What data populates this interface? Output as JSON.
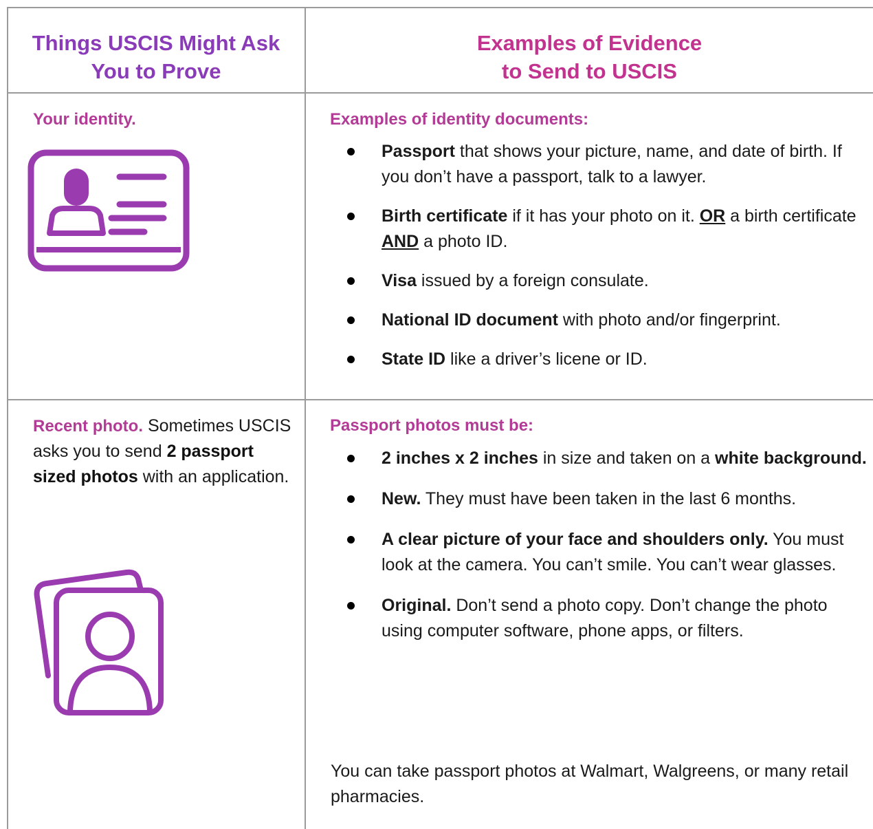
{
  "header": {
    "left_line1": "Things USCIS Might Ask",
    "left_line2": "You to Prove",
    "right_line1": "Examples of Evidence",
    "right_line2": "to Send to USCIS"
  },
  "row1": {
    "left_label": "Your identity.",
    "icon": "id-card-icon",
    "right_title": "Examples of identity documents:",
    "items": [
      {
        "bold": "Passport",
        "text": " that shows your picture, name, and date of birth. If you don’t have a passport, talk to a lawyer."
      },
      {
        "bold": "Birth certificate",
        "text": " if it has your photo on it. ",
        "or": "OR",
        "text2": " a birth certificate ",
        "and": "AND",
        "text3": " a photo ID."
      },
      {
        "bold": "Visa",
        "text": " issued by a foreign consulate."
      },
      {
        "bold": "National ID document",
        "text": " with photo and/or fingerprint."
      },
      {
        "bold": "State ID",
        "text": " like a driver’s licene or ID."
      }
    ]
  },
  "row2": {
    "left_label": "Recent photo.",
    "left_text1": " Sometimes USCIS asks you to send ",
    "left_bold": "2 passport sized photos",
    "left_text2": " with an application.",
    "icon": "photos-icon",
    "right_title": "Passport photos must be:",
    "items": [
      {
        "bold": "2 inches x 2 inches",
        "text": " in size and taken on a ",
        "bold2": "white background."
      },
      {
        "bold": "New.",
        "text": " They must have been taken in the last 6 months."
      },
      {
        "bold": "A clear picture of your face and shoulders only.",
        "text": " You must look at the camera. You can’t smile. You can’t wear glasses."
      },
      {
        "bold": "Original.",
        "text": " Don’t send a photo copy. Don’t change the photo using computer software, phone apps, or filters."
      }
    ],
    "footer": "You can take passport photos at Walmart, Walgreens, or many retail pharmacies."
  },
  "colors": {
    "purple": "#8a3bb8",
    "magenta": "#c2338f",
    "icon": "#9b3bb0",
    "border": "#9a9a9a"
  }
}
